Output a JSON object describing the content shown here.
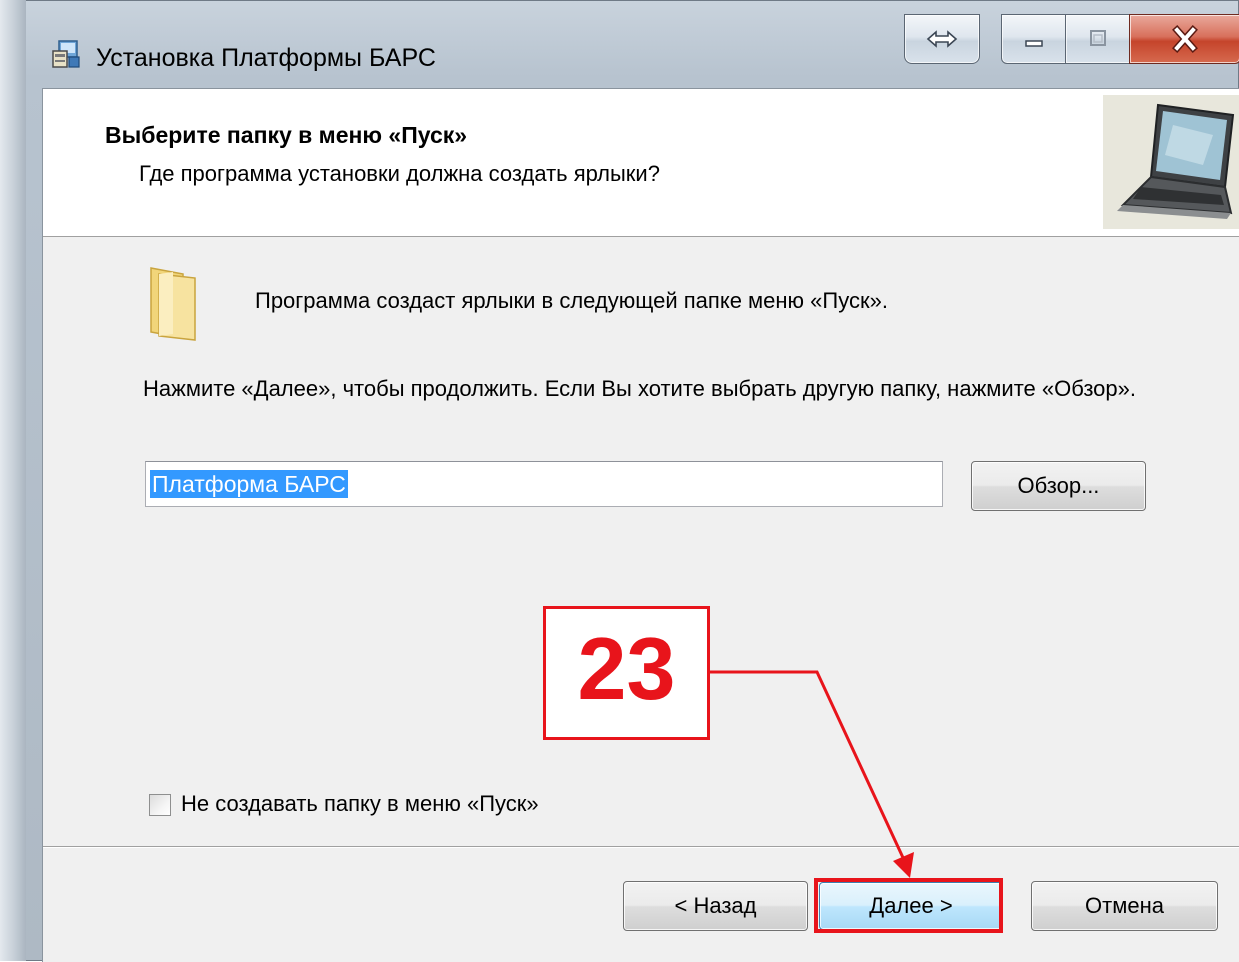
{
  "window": {
    "title": "Установка Платформы БАРС",
    "controls": [
      "resize-icon",
      "minimize-icon",
      "maximize-icon",
      "close-icon"
    ]
  },
  "header": {
    "title": "Выберите папку в меню «Пуск»",
    "subtitle": "Где программа установки должна создать ярлыки?",
    "image": "laptop-image"
  },
  "body": {
    "info_text": "Программа создаст ярлыки в следующей папке меню «Пуск».",
    "instruction_text": "Нажмите «Далее», чтобы продолжить. Если Вы хотите выбрать другую папку, нажмите «Обзор».",
    "folder_input_value": "Платформа БАРС",
    "browse_label": "Обзор...",
    "checkbox_label": "Не создавать папку в меню «Пуск»",
    "checkbox_checked": false
  },
  "footer": {
    "back_label": "< Назад",
    "next_label": "Далее >",
    "cancel_label": "Отмена"
  },
  "annotation": {
    "number": "23",
    "color": "#e8141b",
    "target": "next-button"
  },
  "colors": {
    "selection": "#3399ff",
    "close_button": "#c5442b",
    "default_button_border": "#3c7fb1"
  }
}
